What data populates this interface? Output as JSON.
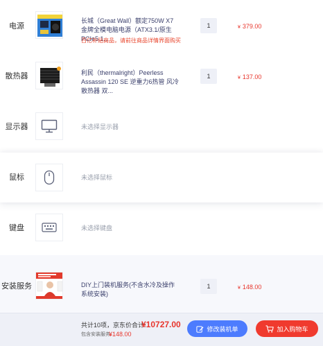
{
  "rows": [
    {
      "category": "电源",
      "title": "长城（Great Wall）额定750W X7金牌全模电脑电源（ATX3.1/原生PCIe5.1...",
      "note": "百亿补贴商品，请前往商品详情界面购买",
      "quantity": "1",
      "price": "379.00",
      "currency": "¥"
    },
    {
      "category": "散热器",
      "title": "利民（thermalright）Peerless Assassin 120 SE 逆重力6热管 风冷散热器 双...",
      "quantity": "1",
      "price": "137.00",
      "currency": "¥"
    },
    {
      "category": "显示器",
      "placeholder": "未选择显示器",
      "icon": "monitor-icon"
    },
    {
      "category": "鼠标",
      "placeholder": "未选择鼠标",
      "icon": "mouse-icon"
    },
    {
      "category": "键盘",
      "placeholder": "未选择键盘",
      "icon": "keyboard-icon"
    },
    {
      "category": "安装服务",
      "title": "DIY上门装机服务(不含水冷及操作系统安装)",
      "quantity": "1",
      "price": "148.00",
      "currency": "¥"
    }
  ],
  "footer": {
    "count_text": "共计10项，京东价合计:",
    "total": "¥10727.00",
    "service_label": "包含安装服务:",
    "service_value": "¥148.00",
    "edit_button": "修改装机单",
    "cart_button": "加入购物车"
  },
  "colors": {
    "accent_blue": "#4d7cfe",
    "accent_red": "#f03a2e",
    "price_red": "#e8352c"
  }
}
